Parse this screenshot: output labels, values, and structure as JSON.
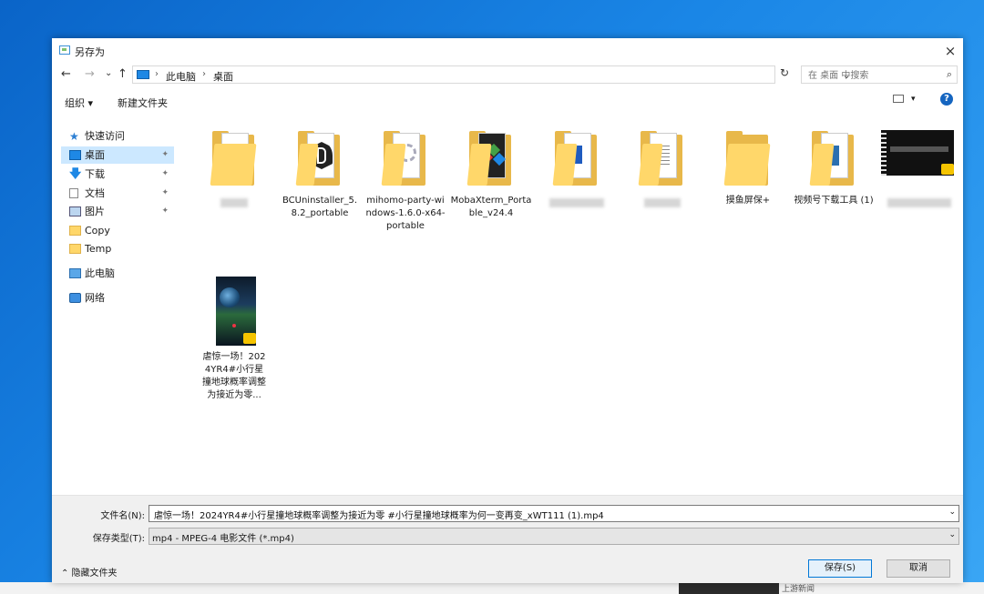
{
  "dialog": {
    "title": "另存为",
    "close": "×"
  },
  "nav": {
    "back": "←",
    "forward": "→",
    "recent": "⌄",
    "up": "↑"
  },
  "address": {
    "root": "此电脑",
    "current": "桌面",
    "sep": "›",
    "dropdown": "⌄",
    "refresh": "↻"
  },
  "search": {
    "placeholder": "在 桌面 中搜索",
    "icon": "⌕"
  },
  "cmdbar": {
    "organize": "组织 ▾",
    "new_folder": "新建文件夹",
    "view_dropdown": "▾",
    "help": "?"
  },
  "sidebar": {
    "items": [
      {
        "label": "快速访问"
      },
      {
        "label": "桌面"
      },
      {
        "label": "下载"
      },
      {
        "label": "文档"
      },
      {
        "label": "图片"
      },
      {
        "label": "Copy"
      },
      {
        "label": "Temp"
      },
      {
        "label": "此电脑"
      },
      {
        "label": "网络"
      }
    ],
    "pin": "📌"
  },
  "files": [
    {
      "label": ""
    },
    {
      "label": "BCUninstaller_5.8.2_portable"
    },
    {
      "label": "mihomo-party-windows-1.6.0-x64-portable"
    },
    {
      "label": "MobaXterm_Portable_v24.4"
    },
    {
      "label": ""
    },
    {
      "label": ""
    },
    {
      "label": "摸鱼屏保+"
    },
    {
      "label": "视频号下载工具 (1)"
    },
    {
      "label": ""
    },
    {
      "label": "虐惊一场！2024YR4#小行星撞地球概率调整为接近为零..."
    }
  ],
  "bottom": {
    "filename_label": "文件名(N):",
    "filename_value": "虐惊一场！2024YR4#小行星撞地球概率调整为接近为零 #小行星撞地球概率为何一变再变_xWT111 (1).mp4",
    "filetype_label": "保存类型(T):",
    "filetype_value": "mp4 - MPEG-4 电影文件 (*.mp4)",
    "dropdown": "⌄",
    "hide_folders": "⌃ 隐藏文件夹",
    "save": "保存(S)",
    "cancel": "取消"
  },
  "taskbar": {
    "text": "上游新闻"
  },
  "colors": {
    "accent": "#0078d7",
    "folder": "#ffd76a",
    "selection": "#cce8ff"
  }
}
